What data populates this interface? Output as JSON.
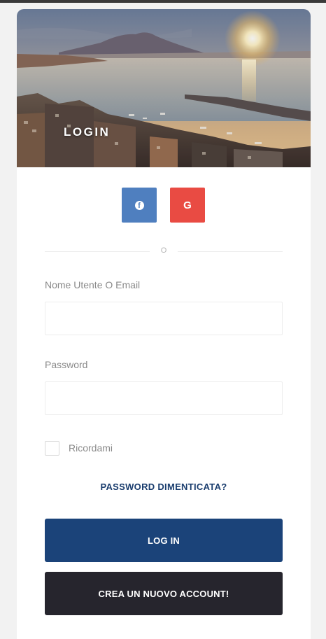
{
  "hero": {
    "title": "LOGIN"
  },
  "social": {
    "facebook_icon_glyph": "f",
    "google_icon_glyph": "G",
    "facebook_color": "#4f7fbf",
    "google_color": "#e94b43"
  },
  "divider": {
    "or_text": "O"
  },
  "form": {
    "username_label": "Nome Utente O Email",
    "username_value": "",
    "password_label": "Password",
    "password_value": "",
    "remember_label": "Ricordami",
    "remember_checked": false,
    "forgot_label": "PASSWORD DIMENTICATA?",
    "login_label": "LOG IN",
    "create_label": "CREA UN NUOVO ACCOUNT!"
  },
  "colors": {
    "primary": "#1b4379",
    "dark": "#26252d",
    "link": "#1a3d6e"
  }
}
